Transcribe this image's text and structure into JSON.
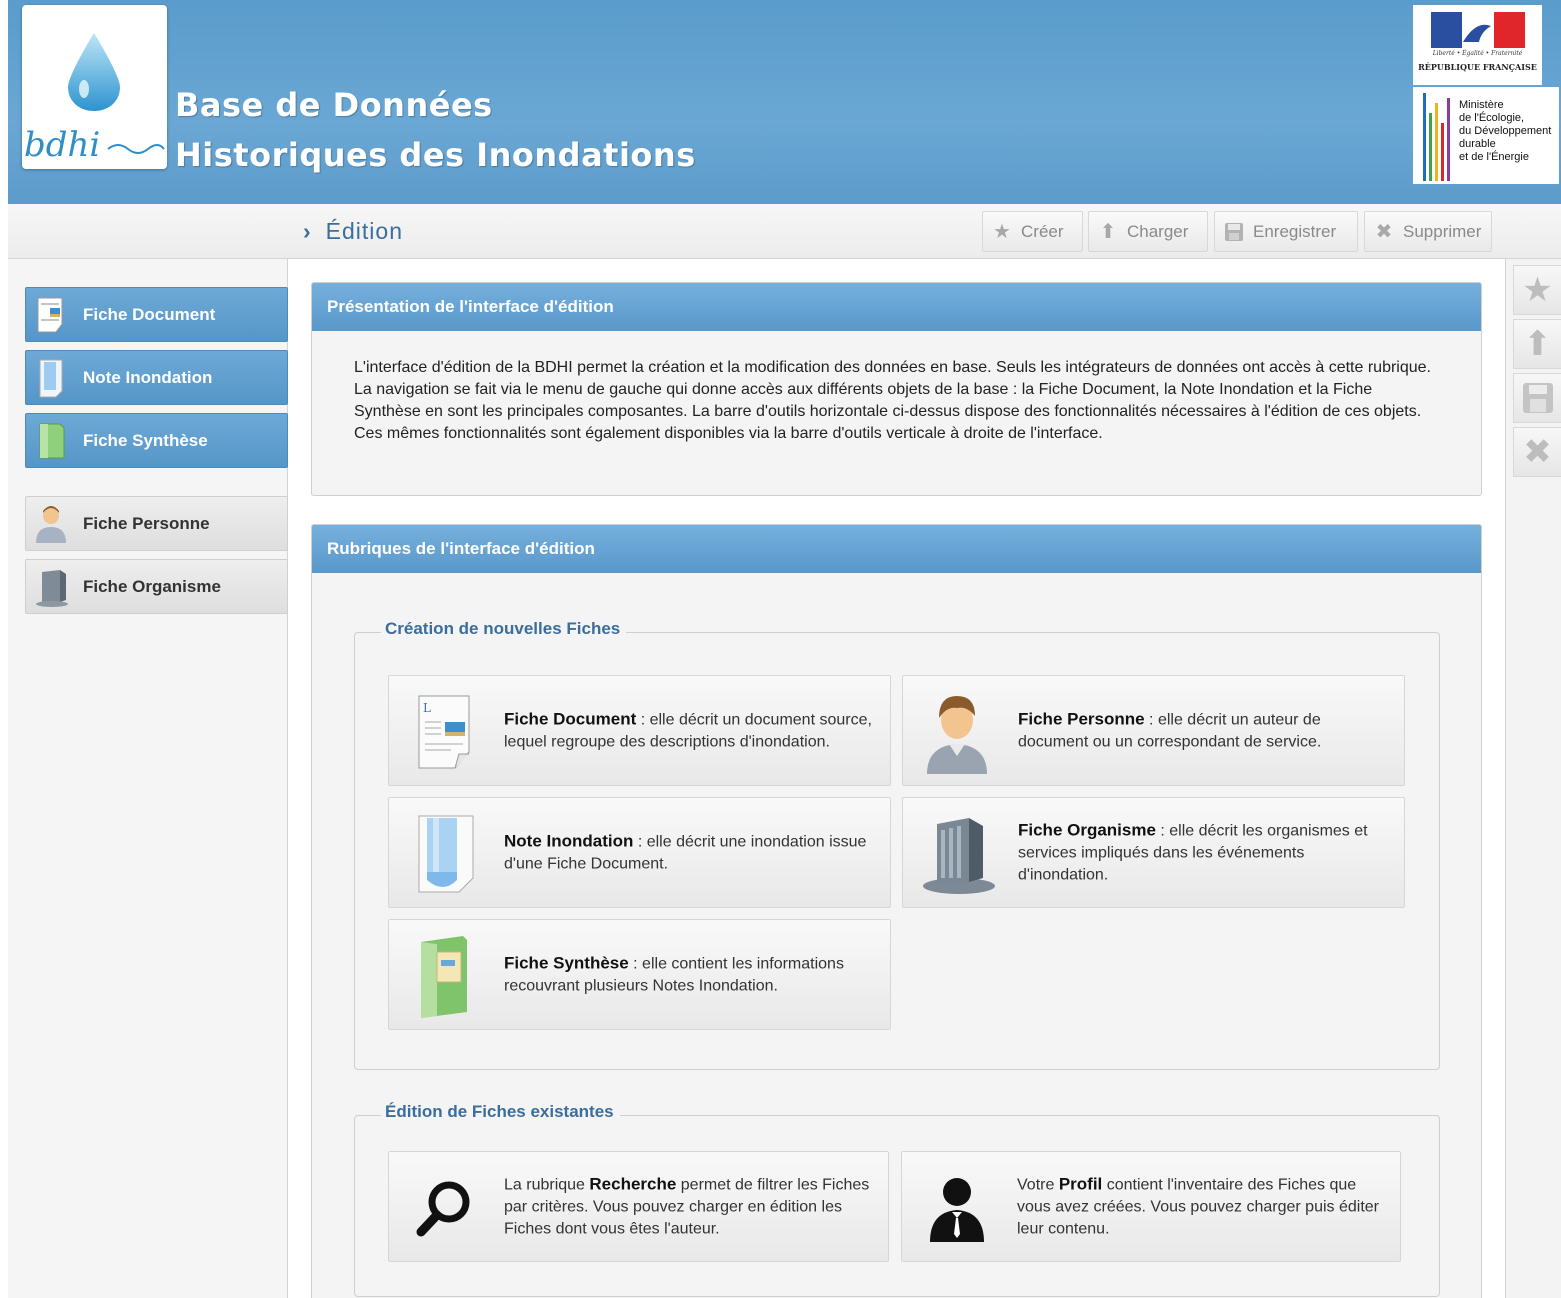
{
  "header": {
    "logo_text": "bdhi",
    "title_line1": "Base de Données",
    "title_line2": "Historiques des Inondations",
    "republic_motto": "Liberté • Égalité • Fraternité",
    "republic_name": "RÉPUBLIQUE FRANÇAISE",
    "ministry_lines": [
      "Ministère",
      "de l'Écologie,",
      "du Développement",
      "durable",
      "et de l'Énergie"
    ]
  },
  "toolbar": {
    "breadcrumb": "Édition",
    "buttons": [
      {
        "label": "Créer",
        "icon": "star-icon"
      },
      {
        "label": "Charger",
        "icon": "upload-icon"
      },
      {
        "label": "Enregistrer",
        "icon": "save-icon"
      },
      {
        "label": "Supprimer",
        "icon": "delete-icon"
      }
    ]
  },
  "sidebar": {
    "items": [
      {
        "label": "Fiche Document",
        "icon": "document-icon",
        "style": "blue"
      },
      {
        "label": "Note Inondation",
        "icon": "flood-note-icon",
        "style": "blue"
      },
      {
        "label": "Fiche Synthèse",
        "icon": "synthesis-icon",
        "style": "blue"
      },
      {
        "label": "Fiche Personne",
        "icon": "person-icon",
        "style": "grey"
      },
      {
        "label": "Fiche Organisme",
        "icon": "building-icon",
        "style": "grey"
      }
    ]
  },
  "right_toolbar": {
    "icons": [
      "star-icon",
      "upload-icon",
      "save-icon",
      "delete-icon"
    ]
  },
  "presentation": {
    "title": "Présentation de l'interface d'édition",
    "text": "L'interface d'édition de la BDHI permet la création et la modification des données en base. Seuls les intégrateurs de données ont accès à cette rubrique. La navigation se fait via le menu de gauche qui donne accès aux différents objets de la base : la Fiche Document, la Note Inondation et la Fiche Synthèse en sont les principales composantes. La barre d'outils horizontale ci-dessus dispose des fonctionnalités nécessaires à l'édition de ces objets. Ces mêmes fonctionnalités sont également disponibles via la barre d'outils verticale à droite de l'interface."
  },
  "rubriques": {
    "title": "Rubriques de l'interface d'édition",
    "creation": {
      "legend": "Création de nouvelles Fiches",
      "cards": [
        {
          "bold": "Fiche Document",
          "text": " : elle décrit un document source, lequel regroupe des descriptions d'inondation.",
          "icon": "document-icon"
        },
        {
          "bold": "Fiche Personne",
          "text": " : elle décrit un auteur de document ou un correspondant de service.",
          "icon": "person-icon"
        },
        {
          "bold": "Note Inondation",
          "text": " : elle décrit une inondation issue d'une Fiche Document.",
          "icon": "flood-note-icon"
        },
        {
          "bold": "Fiche Organisme",
          "text": " : elle décrit les organismes et services impliqués dans les événements d'inondation.",
          "icon": "building-icon"
        },
        {
          "bold": "Fiche Synthèse",
          "text": " : elle contient les informations recouvrant plusieurs Notes Inondation.",
          "icon": "synthesis-icon"
        }
      ]
    },
    "edition": {
      "legend": "Édition de Fiches existantes",
      "cards": [
        {
          "pre": "La rubrique ",
          "bold": "Recherche",
          "text": " permet de filtrer les Fiches par critères. Vous pouvez charger en édition les Fiches dont vous êtes l'auteur.",
          "icon": "search-icon"
        },
        {
          "pre": "Votre ",
          "bold": "Profil",
          "text": " contient l'inventaire des Fiches que vous avez créées. Vous pouvez charger puis éditer leur contenu.",
          "icon": "profile-icon"
        }
      ]
    }
  }
}
